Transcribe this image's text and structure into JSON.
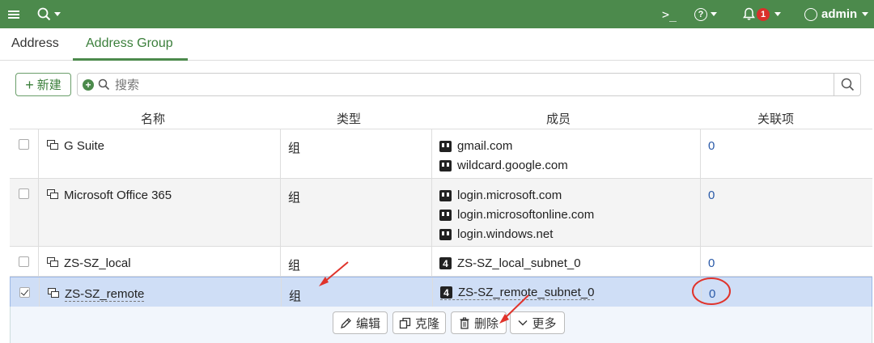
{
  "topbar": {
    "menu_icon": "hamburger-icon",
    "search_icon": "search-icon",
    "console_glyph": ">_",
    "help_glyph": "?",
    "notification_count": "1",
    "user": "admin",
    "bar_color": "#4c8a4c"
  },
  "tabs": [
    {
      "label": "Address",
      "active": false
    },
    {
      "label": "Address Group",
      "active": true
    }
  ],
  "toolbar": {
    "new_label": "新建",
    "new_glyph": "+",
    "search_placeholder": "搜索"
  },
  "table": {
    "headers": [
      "名称",
      "类型",
      "成员",
      "关联项"
    ],
    "rows": [
      {
        "name": "G Suite",
        "type": "组",
        "members": [
          "gmail.com",
          "wildcard.google.com"
        ],
        "member_kind": "address",
        "ref": "0",
        "selected": false
      },
      {
        "name": "Microsoft Office 365",
        "type": "组",
        "members": [
          "login.microsoft.com",
          "login.microsoftonline.com",
          "login.windows.net"
        ],
        "member_kind": "address",
        "ref": "0",
        "selected": false
      },
      {
        "name": "ZS-SZ_local",
        "type": "组",
        "members": [
          "ZS-SZ_local_subnet_0"
        ],
        "member_kind": "subnet",
        "ref": "0",
        "selected": false
      },
      {
        "name": "ZS-SZ_remote",
        "type": "组",
        "members": [
          "ZS-SZ_remote_subnet_0"
        ],
        "member_kind": "subnet",
        "ref": "0",
        "selected": true
      }
    ]
  },
  "actions": {
    "edit": "编辑",
    "clone": "克隆",
    "delete": "删除",
    "more": "更多"
  },
  "colors": {
    "accent": "#4c8a4c",
    "selected_row": "#cfdef6",
    "link": "#2a5aa8",
    "annotation": "#e0332b",
    "badge": "#d9302a"
  }
}
